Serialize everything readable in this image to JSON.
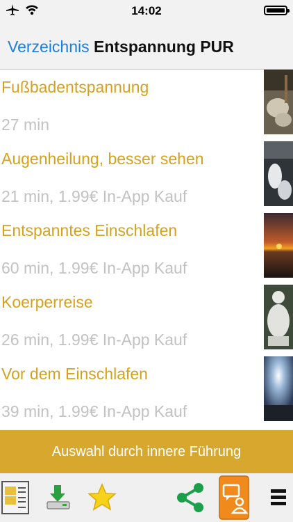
{
  "status": {
    "time": "14:02"
  },
  "nav": {
    "back_label": "Verzeichnis",
    "title": "Entspannung PUR"
  },
  "items": [
    {
      "title": "Fußbadentspannung",
      "meta": "27 min"
    },
    {
      "title": "Augenheilung, besser sehen",
      "meta": "21 min, 1.99€ In-App Kauf"
    },
    {
      "title": "Entspanntes Einschlafen",
      "meta": "60 min, 1.99€ In-App Kauf"
    },
    {
      "title": "Koerperreise",
      "meta": "26 min, 1.99€ In-App Kauf"
    },
    {
      "title": "Vor dem Einschlafen",
      "meta": "39 min, 1.99€ In-App Kauf"
    }
  ],
  "action_button": {
    "label": "Auswahl durch innere Führung"
  },
  "colors": {
    "accent": "#d8a72e",
    "title_text": "#d4a21e",
    "link": "#1a7ee0",
    "share": "#1aa04a",
    "orange": "#f08a1c"
  }
}
